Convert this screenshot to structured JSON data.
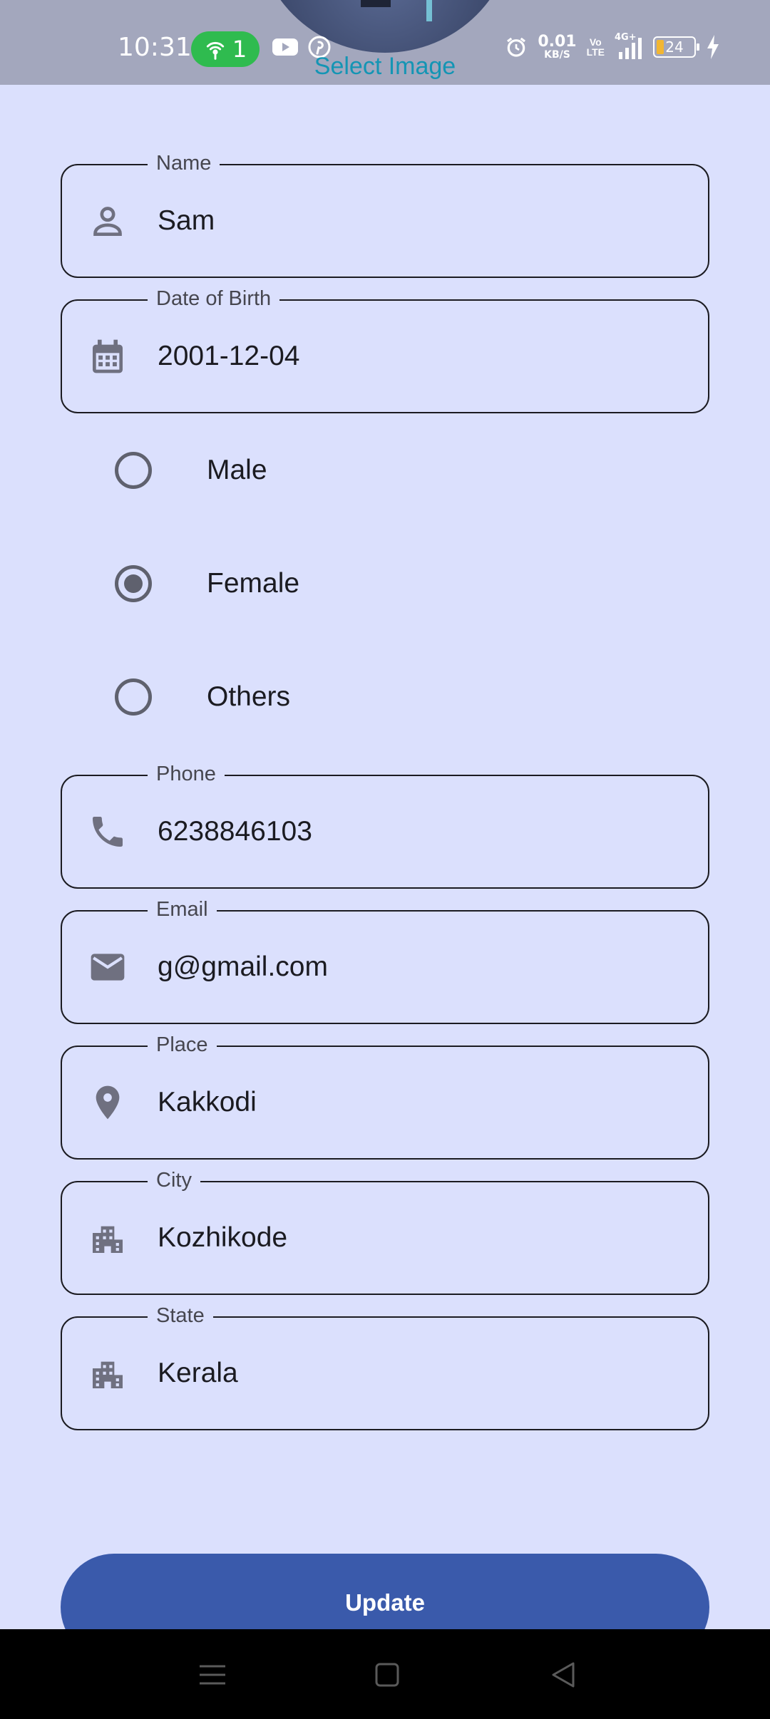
{
  "status_bar": {
    "time": "10:31",
    "hotspot_count": "1",
    "net_speed_value": "0.01",
    "net_speed_unit": "KB/S",
    "volte_top": "Vo",
    "volte_bottom": "LTE",
    "signal_label": "4G+",
    "battery_level": "24"
  },
  "header": {
    "select_image_label": "Select Image"
  },
  "form": {
    "name": {
      "label": "Name",
      "value": "Sam",
      "icon": "person-icon"
    },
    "dob": {
      "label": "Date of Birth",
      "value": "2001-12-04",
      "icon": "calendar-icon"
    },
    "gender": {
      "options": [
        "Male",
        "Female",
        "Others"
      ],
      "selected": "Female"
    },
    "phone": {
      "label": "Phone",
      "value": "6238846103",
      "icon": "phone-icon"
    },
    "email": {
      "label": "Email",
      "value": "g@gmail.com",
      "icon": "mail-icon"
    },
    "place": {
      "label": "Place",
      "value": "Kakkodi",
      "icon": "location-pin-icon"
    },
    "city": {
      "label": "City",
      "value": "Kozhikode",
      "icon": "building-icon"
    },
    "state": {
      "label": "State",
      "value": "Kerala",
      "icon": "building-icon"
    }
  },
  "actions": {
    "update_label": "Update"
  },
  "colors": {
    "background": "#dbe0fd",
    "status_bar": "#a3a7bd",
    "accent_link": "#1495b4",
    "primary_button": "#3a5aab",
    "hotspot_green": "#2fbb4f",
    "icon_gray": "#6f7080"
  }
}
